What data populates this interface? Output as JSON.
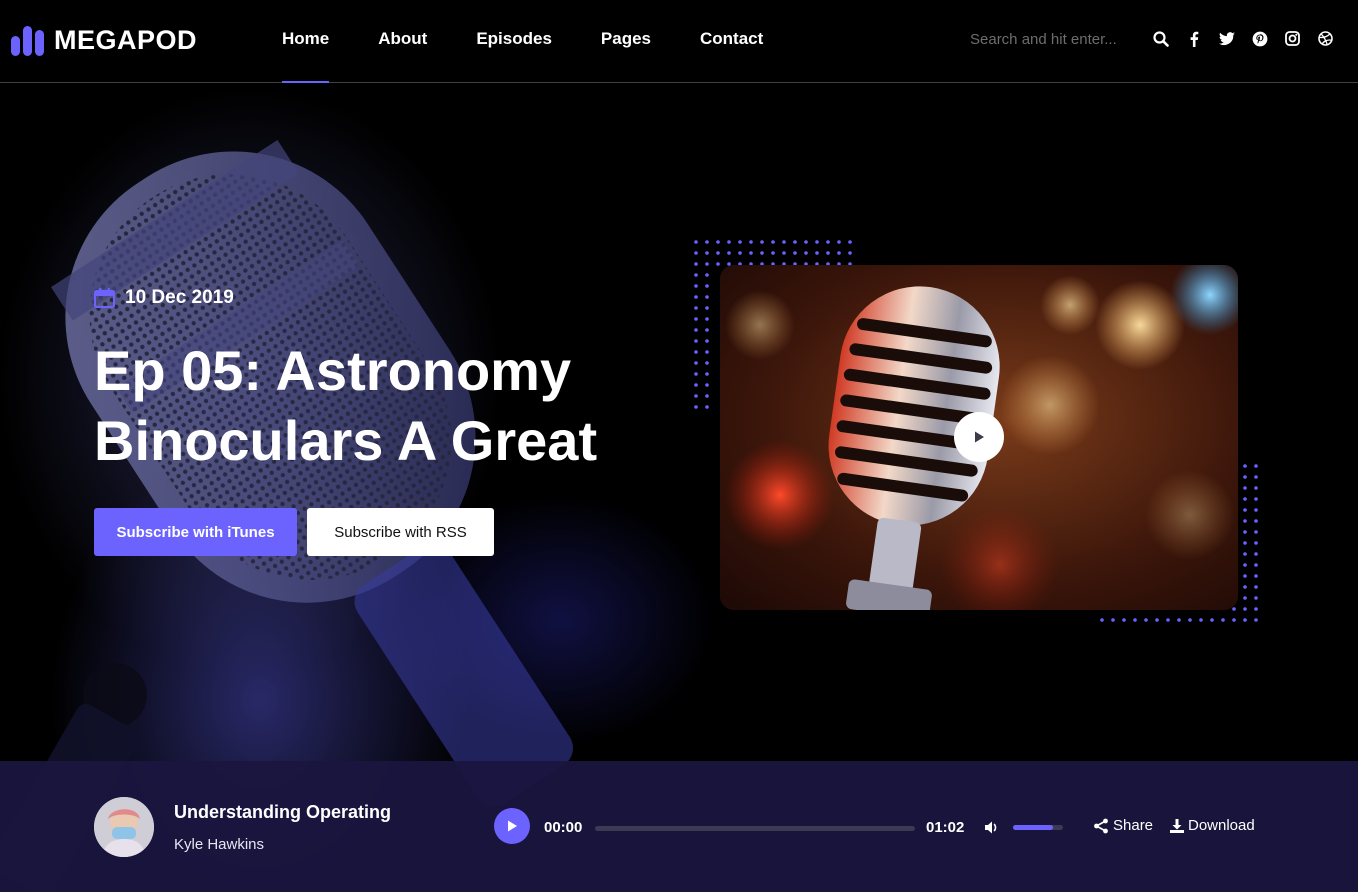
{
  "brand": {
    "name": "MEGAPOD",
    "accent": "#6c63ff"
  },
  "nav": {
    "items": [
      {
        "label": "Home",
        "active": true
      },
      {
        "label": "About",
        "active": false
      },
      {
        "label": "Episodes",
        "active": false
      },
      {
        "label": "Pages",
        "active": false
      },
      {
        "label": "Contact",
        "active": false
      }
    ]
  },
  "search": {
    "placeholder": "Search and hit enter..."
  },
  "social_icons": [
    "search-icon",
    "facebook-icon",
    "twitter-icon",
    "pinterest-icon",
    "instagram-icon",
    "dribbble-icon"
  ],
  "hero": {
    "date": "10 Dec 2019",
    "title": "Ep 05: Astronomy Binoculars A Great",
    "buttons": {
      "itunes": "Subscribe with iTunes",
      "rss": "Subscribe with RSS"
    }
  },
  "player": {
    "track_title": "Understanding Operating",
    "artist": "Kyle Hawkins",
    "current_time": "00:00",
    "duration": "01:02",
    "progress": 0,
    "volume": 0.8,
    "share_label": "Share",
    "download_label": "Download"
  }
}
